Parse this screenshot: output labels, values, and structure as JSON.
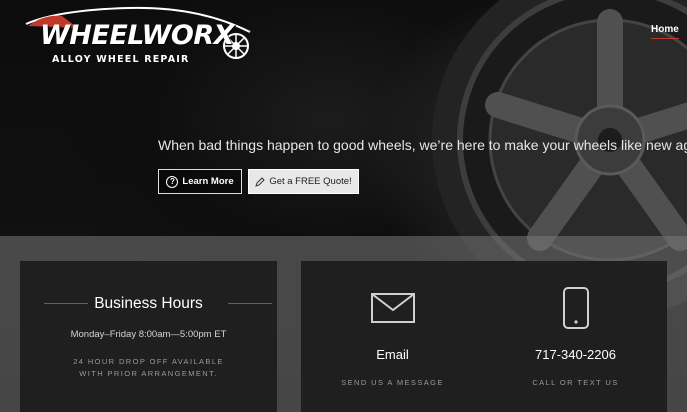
{
  "brand": {
    "name": "WHEELWORX",
    "subtitle": "ALLOY WHEEL REPAIR",
    "accent_color": "#c0392b"
  },
  "nav": {
    "items": [
      {
        "label": "Home",
        "active": true
      }
    ]
  },
  "hero": {
    "tagline": "When bad things happen to good wheels, we’re here to make your wheels like new again.",
    "learn_more_label": "Learn More",
    "quote_label": "Get a FREE Quote!",
    "learn_more_icon": "question-circle-icon",
    "quote_icon": "pencil-icon"
  },
  "hours": {
    "title": "Business Hours",
    "schedule": "Monday–Friday 8:00am—5:00pm ET",
    "note_line1": "24 HOUR DROP OFF AVAILABLE",
    "note_line2": "WITH PRIOR ARRANGEMENT."
  },
  "contact": {
    "email": {
      "title": "Email",
      "subtitle": "SEND US A MESSAGE",
      "icon": "envelope-icon"
    },
    "phone": {
      "title": "717-340-2206",
      "subtitle": "CALL OR TEXT US",
      "icon": "smartphone-icon"
    }
  }
}
